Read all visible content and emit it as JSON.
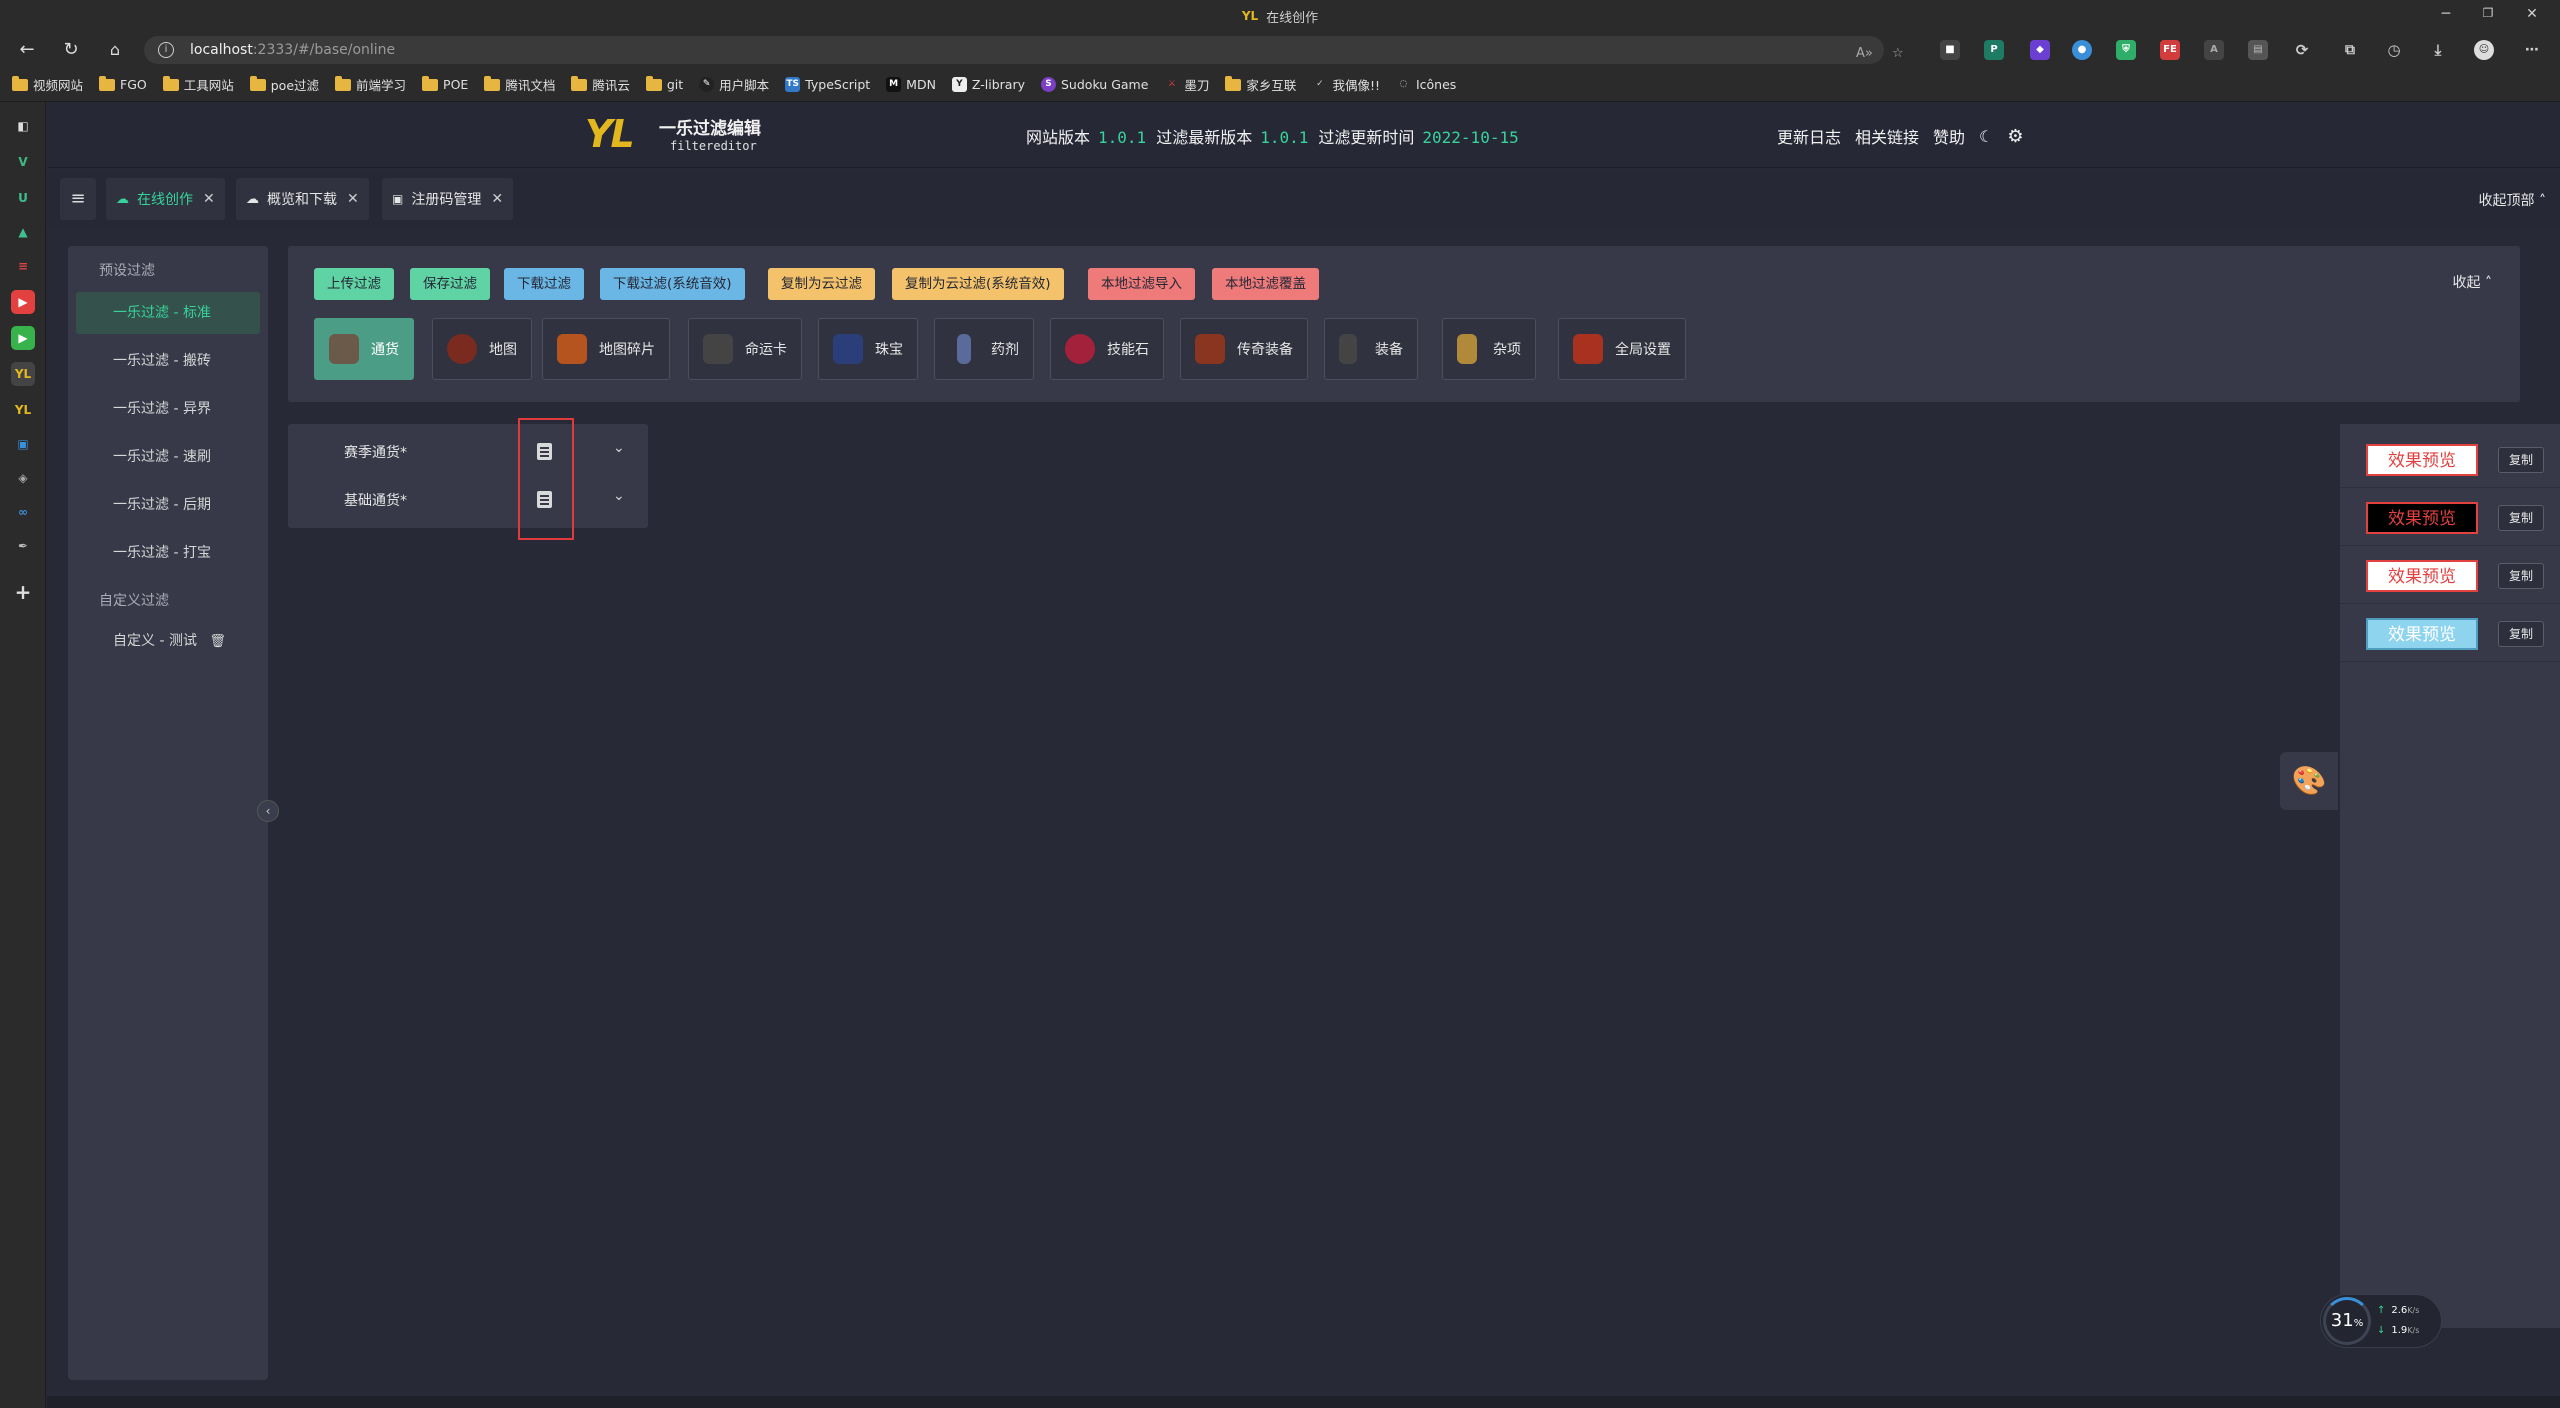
{
  "browser": {
    "window_title": "在线创作",
    "title_logo": "YL",
    "url_host": "localhost",
    "url_path": ":2333/#/base/online",
    "bookmarks": [
      "视频网站",
      "FGO",
      "工具网站",
      "poe过滤",
      "前端学习",
      "POE",
      "腾讯文档",
      "腾讯云",
      "git",
      "用户脚本",
      "TypeScript",
      "MDN",
      "Z-library",
      "Sudoku Game",
      "墨刀",
      "家乡互联",
      "我偶像!!",
      "Icônes"
    ]
  },
  "app": {
    "logo": "YL",
    "name": "一乐过滤编辑",
    "subtitle": "filtereditor",
    "site_version_label": "网站版本",
    "site_version": "1.0.1",
    "filter_version_label": "过滤最新版本",
    "filter_version": "1.0.1",
    "update_time_label": "过滤更新时间",
    "update_time": "2022-10-15",
    "links": [
      "更新日志",
      "相关链接",
      "赞助"
    ]
  },
  "tabs": [
    {
      "label": "在线创作",
      "active": true
    },
    {
      "label": "概览和下载",
      "active": false
    },
    {
      "label": "注册码管理",
      "active": false
    }
  ],
  "collapse_top": "收起顶部",
  "nav": {
    "group1": "预设过滤",
    "items1": [
      "一乐过滤 - 标准",
      "一乐过滤 - 搬砖",
      "一乐过滤 - 异界",
      "一乐过滤 - 速刷",
      "一乐过滤 - 后期",
      "一乐过滤 - 打宝"
    ],
    "group2": "自定义过滤",
    "items2": [
      "自定义 - 测试"
    ]
  },
  "actions": [
    {
      "label": "上传过滤",
      "color": "#5fd3a4"
    },
    {
      "label": "保存过滤",
      "color": "#5fd3a4"
    },
    {
      "label": "下载过滤",
      "color": "#6ab6e4"
    },
    {
      "label": "下载过滤(系统音效)",
      "color": "#6ab6e4"
    },
    {
      "label": "复制为云过滤",
      "color": "#f3c26a"
    },
    {
      "label": "复制为云过滤(系统音效)",
      "color": "#f3c26a"
    },
    {
      "label": "本地过滤导入",
      "color": "#ee7a7a"
    },
    {
      "label": "本地过滤覆盖",
      "color": "#ee7a7a"
    }
  ],
  "collapse_label": "收起",
  "categories": [
    {
      "label": "通货",
      "icon": "currency-icon",
      "active": true
    },
    {
      "label": "地图",
      "icon": "map-icon",
      "active": false
    },
    {
      "label": "地图碎片",
      "icon": "map-fragment-icon",
      "active": false
    },
    {
      "label": "命运卡",
      "icon": "divination-card-icon",
      "active": false
    },
    {
      "label": "珠宝",
      "icon": "jewel-icon",
      "active": false
    },
    {
      "label": "药剂",
      "icon": "flask-icon",
      "active": false
    },
    {
      "label": "技能石",
      "icon": "gem-icon",
      "active": false
    },
    {
      "label": "传奇装备",
      "icon": "unique-icon",
      "active": false
    },
    {
      "label": "装备",
      "icon": "equipment-icon",
      "active": false
    },
    {
      "label": "杂项",
      "icon": "misc-icon",
      "active": false
    },
    {
      "label": "全局设置",
      "icon": "global-settings-icon",
      "active": false
    }
  ],
  "currency_rows": [
    "赛季通货*",
    "基础通货*"
  ],
  "previews": [
    {
      "label": "效果预览",
      "bg": "#ffffff",
      "fg": "#e34040",
      "border": "#e34040",
      "copy": "复制"
    },
    {
      "label": "效果预览",
      "bg": "#000000",
      "fg": "#e34040",
      "border": "#e34040",
      "copy": "复制"
    },
    {
      "label": "效果预览",
      "bg": "#ffffff",
      "fg": "#e34040",
      "border": "#e34040",
      "copy": "复制"
    },
    {
      "label": "效果预览",
      "bg": "#8ed4ef",
      "fg": "#ffffff",
      "border": "#4e9dbf",
      "copy": "复制"
    }
  ],
  "speed": {
    "percent": "31",
    "unit": "%",
    "up": "2.6",
    "down": "1.9",
    "rate_unit": "K/s"
  }
}
